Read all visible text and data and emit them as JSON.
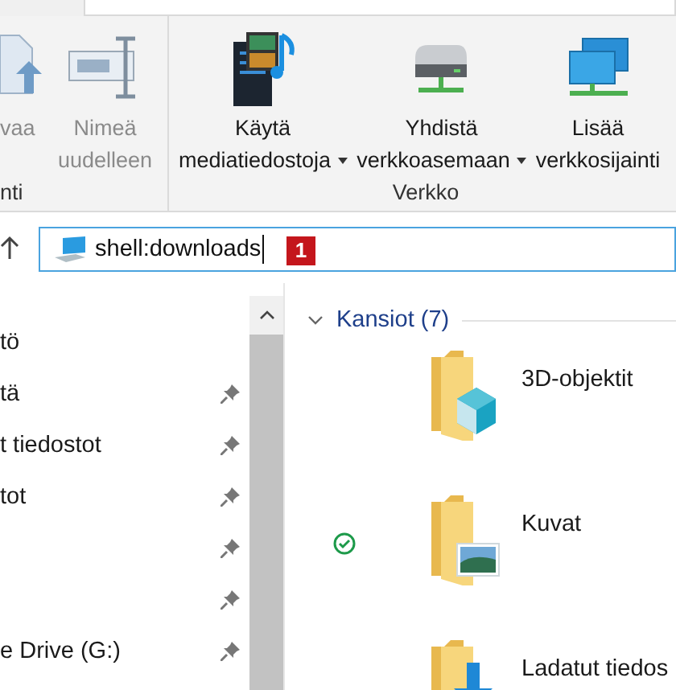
{
  "ribbon": {
    "groups": [
      {
        "label": "nti",
        "buttons": [
          {
            "lines": [
              "vaa"
            ],
            "kind": "paste",
            "disabled": true,
            "dropdown": false
          },
          {
            "lines": [
              "Nimeä",
              "uudelleen"
            ],
            "kind": "rename",
            "disabled": true,
            "dropdown": false
          }
        ]
      },
      {
        "label": "Verkko",
        "buttons": [
          {
            "lines": [
              "Käytä",
              "mediatiedostoja"
            ],
            "kind": "media",
            "disabled": false,
            "dropdown": true
          },
          {
            "lines": [
              "Yhdistä",
              "verkkoasemaan"
            ],
            "kind": "drive",
            "disabled": false,
            "dropdown": true
          },
          {
            "lines": [
              "Lisää",
              "verkkosijainti"
            ],
            "kind": "network",
            "disabled": false,
            "dropdown": false
          }
        ]
      }
    ]
  },
  "address": {
    "path": "shell:downloads",
    "badge": "1"
  },
  "navigation": {
    "items": [
      {
        "label": "tö",
        "pinned": false
      },
      {
        "label": "tä",
        "pinned": true
      },
      {
        "label": "t tiedostot",
        "pinned": true
      },
      {
        "label": "tot",
        "pinned": true
      },
      {
        "pinned": true
      },
      {
        "pinned": true
      },
      {
        "label": "e Drive (G:)",
        "pinned": true
      }
    ]
  },
  "content": {
    "groups": [
      {
        "label": "Kansiot (7)",
        "expanded": true,
        "items": [
          {
            "name": "3D-objektit",
            "kind": "cube",
            "synced": false
          },
          {
            "name": "Kuvat",
            "kind": "pictures",
            "synced": true
          },
          {
            "name": "Ladatut tiedos",
            "kind": "download",
            "synced": false
          }
        ]
      }
    ]
  }
}
